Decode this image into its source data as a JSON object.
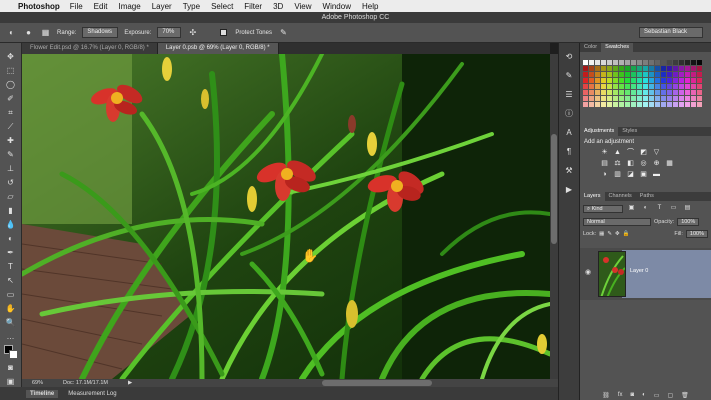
{
  "menubar": {
    "app": "Photoshop",
    "items": [
      "File",
      "Edit",
      "Image",
      "Layer",
      "Type",
      "Select",
      "Filter",
      "3D",
      "View",
      "Window",
      "Help"
    ]
  },
  "window": {
    "title": "Adobe Photoshop CC"
  },
  "options": {
    "range_label": "Range:",
    "range_value": "Shadows",
    "exposure_label": "Exposure:",
    "exposure_value": "70%",
    "protect_label": "Protect Tones",
    "workspace": "Sebastian Black"
  },
  "tabs": [
    {
      "label": "Flower Edit.psd @ 16.7% (Layer 0, RGB/8) *",
      "active": false
    },
    {
      "label": "Layer 0.psb @ 69% (Layer 0, RGB/8) *",
      "active": true
    }
  ],
  "status": {
    "zoom": "69%",
    "doc": "Doc: 17.1M/17.1M"
  },
  "timeline": {
    "tabs": [
      "Timeline",
      "Measurement Log"
    ]
  },
  "panels": {
    "color_tabs": [
      "Color",
      "Swatches"
    ],
    "adjustments_tabs": [
      "Adjustments",
      "Styles"
    ],
    "add_adjustment": "Add an adjustment",
    "layers_tabs": [
      "Layers",
      "Channels",
      "Paths"
    ],
    "kind": "Kind",
    "blend_mode": "Normal",
    "opacity_label": "Opacity:",
    "opacity_value": "100%",
    "lock_label": "Lock:",
    "fill_label": "Fill:",
    "fill_value": "100%",
    "layer_name": "Layer 0"
  },
  "icons": {
    "eye": "eye-icon",
    "hand_cursor": "hand-cursor-icon"
  }
}
